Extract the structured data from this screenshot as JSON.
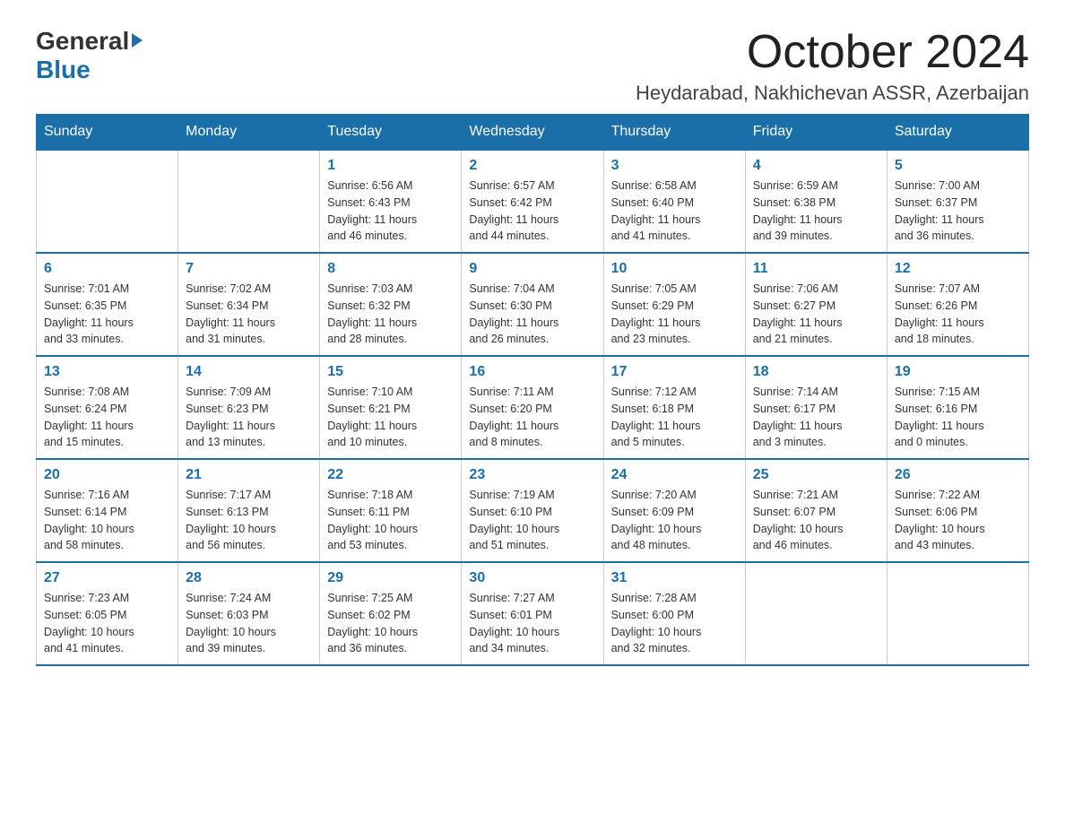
{
  "header": {
    "logo_general": "General",
    "logo_blue": "Blue",
    "month_title": "October 2024",
    "location": "Heydarabad, Nakhichevan ASSR, Azerbaijan"
  },
  "days_of_week": [
    "Sunday",
    "Monday",
    "Tuesday",
    "Wednesday",
    "Thursday",
    "Friday",
    "Saturday"
  ],
  "weeks": [
    [
      {
        "day": "",
        "info": ""
      },
      {
        "day": "",
        "info": ""
      },
      {
        "day": "1",
        "info": "Sunrise: 6:56 AM\nSunset: 6:43 PM\nDaylight: 11 hours\nand 46 minutes."
      },
      {
        "day": "2",
        "info": "Sunrise: 6:57 AM\nSunset: 6:42 PM\nDaylight: 11 hours\nand 44 minutes."
      },
      {
        "day": "3",
        "info": "Sunrise: 6:58 AM\nSunset: 6:40 PM\nDaylight: 11 hours\nand 41 minutes."
      },
      {
        "day": "4",
        "info": "Sunrise: 6:59 AM\nSunset: 6:38 PM\nDaylight: 11 hours\nand 39 minutes."
      },
      {
        "day": "5",
        "info": "Sunrise: 7:00 AM\nSunset: 6:37 PM\nDaylight: 11 hours\nand 36 minutes."
      }
    ],
    [
      {
        "day": "6",
        "info": "Sunrise: 7:01 AM\nSunset: 6:35 PM\nDaylight: 11 hours\nand 33 minutes."
      },
      {
        "day": "7",
        "info": "Sunrise: 7:02 AM\nSunset: 6:34 PM\nDaylight: 11 hours\nand 31 minutes."
      },
      {
        "day": "8",
        "info": "Sunrise: 7:03 AM\nSunset: 6:32 PM\nDaylight: 11 hours\nand 28 minutes."
      },
      {
        "day": "9",
        "info": "Sunrise: 7:04 AM\nSunset: 6:30 PM\nDaylight: 11 hours\nand 26 minutes."
      },
      {
        "day": "10",
        "info": "Sunrise: 7:05 AM\nSunset: 6:29 PM\nDaylight: 11 hours\nand 23 minutes."
      },
      {
        "day": "11",
        "info": "Sunrise: 7:06 AM\nSunset: 6:27 PM\nDaylight: 11 hours\nand 21 minutes."
      },
      {
        "day": "12",
        "info": "Sunrise: 7:07 AM\nSunset: 6:26 PM\nDaylight: 11 hours\nand 18 minutes."
      }
    ],
    [
      {
        "day": "13",
        "info": "Sunrise: 7:08 AM\nSunset: 6:24 PM\nDaylight: 11 hours\nand 15 minutes."
      },
      {
        "day": "14",
        "info": "Sunrise: 7:09 AM\nSunset: 6:23 PM\nDaylight: 11 hours\nand 13 minutes."
      },
      {
        "day": "15",
        "info": "Sunrise: 7:10 AM\nSunset: 6:21 PM\nDaylight: 11 hours\nand 10 minutes."
      },
      {
        "day": "16",
        "info": "Sunrise: 7:11 AM\nSunset: 6:20 PM\nDaylight: 11 hours\nand 8 minutes."
      },
      {
        "day": "17",
        "info": "Sunrise: 7:12 AM\nSunset: 6:18 PM\nDaylight: 11 hours\nand 5 minutes."
      },
      {
        "day": "18",
        "info": "Sunrise: 7:14 AM\nSunset: 6:17 PM\nDaylight: 11 hours\nand 3 minutes."
      },
      {
        "day": "19",
        "info": "Sunrise: 7:15 AM\nSunset: 6:16 PM\nDaylight: 11 hours\nand 0 minutes."
      }
    ],
    [
      {
        "day": "20",
        "info": "Sunrise: 7:16 AM\nSunset: 6:14 PM\nDaylight: 10 hours\nand 58 minutes."
      },
      {
        "day": "21",
        "info": "Sunrise: 7:17 AM\nSunset: 6:13 PM\nDaylight: 10 hours\nand 56 minutes."
      },
      {
        "day": "22",
        "info": "Sunrise: 7:18 AM\nSunset: 6:11 PM\nDaylight: 10 hours\nand 53 minutes."
      },
      {
        "day": "23",
        "info": "Sunrise: 7:19 AM\nSunset: 6:10 PM\nDaylight: 10 hours\nand 51 minutes."
      },
      {
        "day": "24",
        "info": "Sunrise: 7:20 AM\nSunset: 6:09 PM\nDaylight: 10 hours\nand 48 minutes."
      },
      {
        "day": "25",
        "info": "Sunrise: 7:21 AM\nSunset: 6:07 PM\nDaylight: 10 hours\nand 46 minutes."
      },
      {
        "day": "26",
        "info": "Sunrise: 7:22 AM\nSunset: 6:06 PM\nDaylight: 10 hours\nand 43 minutes."
      }
    ],
    [
      {
        "day": "27",
        "info": "Sunrise: 7:23 AM\nSunset: 6:05 PM\nDaylight: 10 hours\nand 41 minutes."
      },
      {
        "day": "28",
        "info": "Sunrise: 7:24 AM\nSunset: 6:03 PM\nDaylight: 10 hours\nand 39 minutes."
      },
      {
        "day": "29",
        "info": "Sunrise: 7:25 AM\nSunset: 6:02 PM\nDaylight: 10 hours\nand 36 minutes."
      },
      {
        "day": "30",
        "info": "Sunrise: 7:27 AM\nSunset: 6:01 PM\nDaylight: 10 hours\nand 34 minutes."
      },
      {
        "day": "31",
        "info": "Sunrise: 7:28 AM\nSunset: 6:00 PM\nDaylight: 10 hours\nand 32 minutes."
      },
      {
        "day": "",
        "info": ""
      },
      {
        "day": "",
        "info": ""
      }
    ]
  ]
}
